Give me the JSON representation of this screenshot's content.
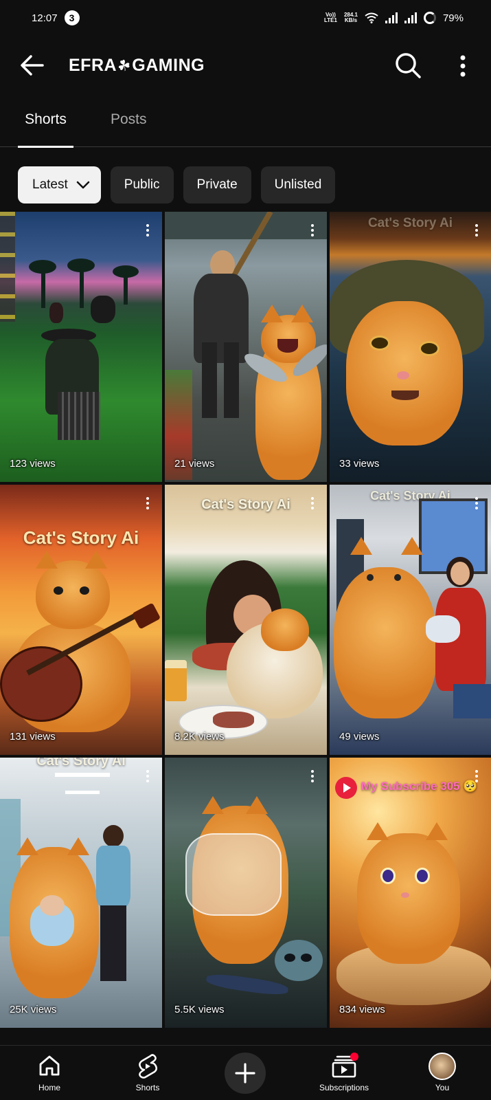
{
  "status_bar": {
    "time": "12:07",
    "notification_count": "3",
    "net_top": "Vo))",
    "net_bottom": "LTE1",
    "speed_top": "284.1",
    "speed_bottom": "KB/s",
    "battery": "79%"
  },
  "header": {
    "title_left": "EFRA",
    "title_right": "GAMING"
  },
  "tabs": [
    {
      "label": "Shorts",
      "active": true
    },
    {
      "label": "Posts",
      "active": false
    }
  ],
  "filters": [
    {
      "label": "Latest",
      "selected": true
    },
    {
      "label": "Public"
    },
    {
      "label": "Private"
    },
    {
      "label": "Unlisted"
    }
  ],
  "shorts": [
    {
      "views": "123 views"
    },
    {
      "views": "21 views"
    },
    {
      "views": "33 views",
      "overlay": "Cat's Story Ai"
    },
    {
      "views": "131 views",
      "overlay": "Cat's Story Ai"
    },
    {
      "views": "8.2K views",
      "overlay": "Cat's Story Ai"
    },
    {
      "views": "49 views",
      "overlay": "Cat's Story Ai"
    },
    {
      "views": "25K views",
      "overlay": "Cat's Story Ai"
    },
    {
      "views": "5.5K views"
    },
    {
      "views": "834 views",
      "overlay": "My Subscribe 305"
    }
  ],
  "bottom_nav": {
    "home": "Home",
    "shorts": "Shorts",
    "subscriptions": "Subscriptions",
    "you": "You"
  },
  "colors": {
    "background": "#0f0f0f",
    "chip": "#272727",
    "chip_selected": "#f1f1f1",
    "notification_dot": "#ff0033"
  }
}
